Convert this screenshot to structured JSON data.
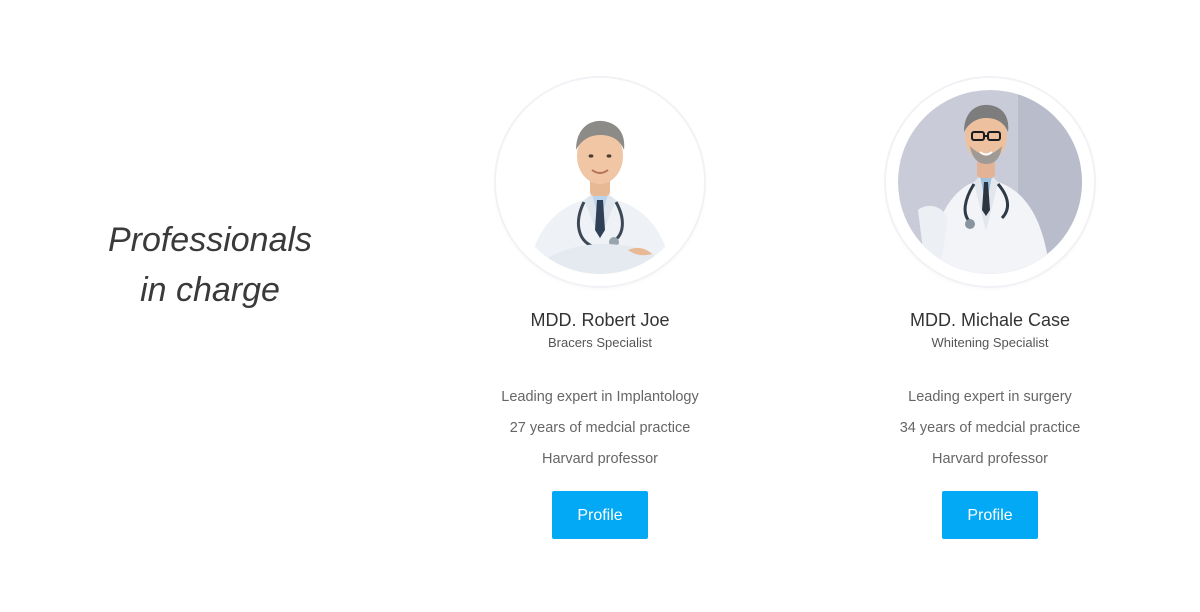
{
  "section": {
    "title_line1": "Professionals",
    "title_line2": "in charge"
  },
  "colors": {
    "accent": "#03a9f4",
    "title_text": "#3a3a3a",
    "body_text": "#666666"
  },
  "doctors": [
    {
      "name": "MDD. Robert Joe",
      "role": "Bracers Specialist",
      "facts": [
        "Leading expert in Implantology",
        "27 years of medcial practice",
        "Harvard professor"
      ],
      "button_label": "Profile",
      "photo_icon": "doctor-portrait-icon"
    },
    {
      "name": "MDD. Michale Case",
      "role": "Whitening Specialist",
      "facts": [
        "Leading expert in surgery",
        "34 years of medcial practice",
        "Harvard professor"
      ],
      "button_label": "Profile",
      "photo_icon": "doctor-portrait-icon"
    }
  ]
}
